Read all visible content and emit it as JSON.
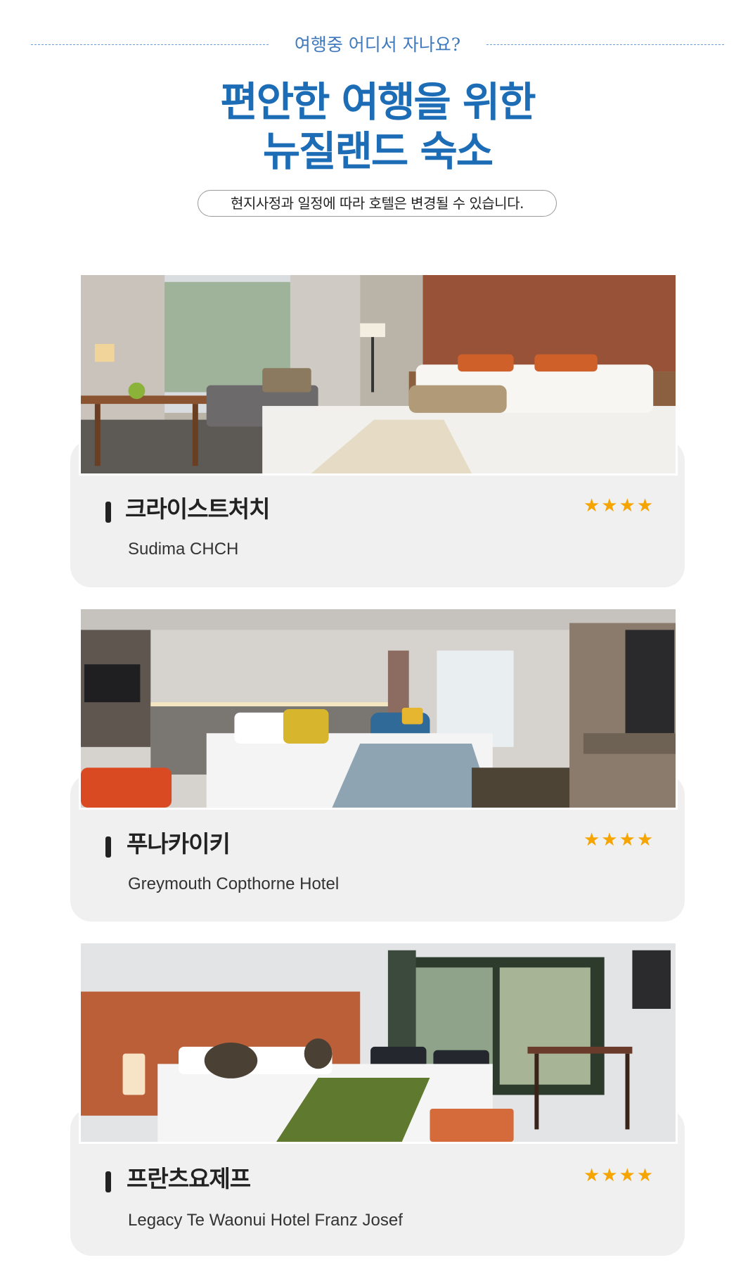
{
  "header": {
    "eyebrow": "여행중 어디서 자나요?",
    "title_line1": "편안한 여행을 위한",
    "title_line2": "뉴질랜드 숙소",
    "notice": "현지사정과 일정에 따라 호텔은 변경될 수 있습니다."
  },
  "hotels": [
    {
      "region": "크라이스트처치",
      "name": "Sudima CHCH",
      "stars": "★★★★",
      "rating": 4,
      "photo_icon": "hotel-room-photo"
    },
    {
      "region": "푸나카이키",
      "name": "Greymouth Copthorne Hotel",
      "stars": "★★★★",
      "rating": 4,
      "photo_icon": "hotel-room-photo"
    },
    {
      "region": "프란츠요제프",
      "name": "Legacy Te Waonui Hotel Franz Josef",
      "stars": "★★★★",
      "rating": 4,
      "photo_icon": "hotel-room-photo"
    }
  ],
  "colors": {
    "accent": "#1d6cb6",
    "star": "#f5a400",
    "card_bg": "#f0f0f0"
  }
}
